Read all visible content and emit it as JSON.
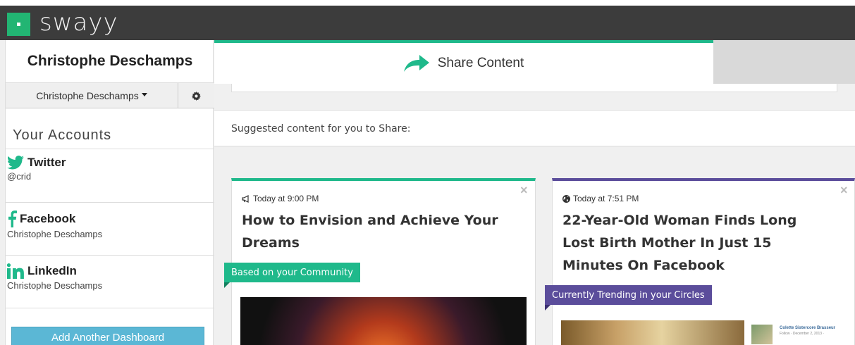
{
  "app": {
    "logo_text": "swayy"
  },
  "sidebar": {
    "user_name": "Christophe Deschamps",
    "user_dropdown": "Christophe Deschamps",
    "accounts_title": "Your Accounts",
    "accounts": [
      {
        "network": "Twitter",
        "handle": "@crid",
        "icon": "twitter-icon",
        "color": "#1fb98b"
      },
      {
        "network": "Facebook",
        "handle": "Christophe Deschamps",
        "icon": "facebook-icon",
        "color": "#1fb98b"
      },
      {
        "network": "LinkedIn",
        "handle": "Christophe Deschamps",
        "icon": "linkedin-icon",
        "color": "#1fb98b"
      }
    ],
    "add_dashboard": "Add Another Dashboard"
  },
  "main": {
    "tab_label": "Share Content",
    "suggested_label": "Suggested content for you to Share:",
    "cards": [
      {
        "time": "Today at 9:00 PM",
        "time_icon": "megaphone-icon",
        "title_lines": [
          "How to Envision and Achieve Your",
          "Dreams"
        ],
        "tag": "Based on your Community",
        "close": "×"
      },
      {
        "time": "Today at 7:51 PM",
        "time_icon": "globe-icon",
        "title_lines": [
          "22-Year-Old Woman Finds Long",
          "Lost Birth Mother In Just 15",
          "Minutes On Facebook"
        ],
        "tag": "Currently Trending in your Circles",
        "close": "×",
        "thumb_name": "Colette Sistercore Brasseur",
        "thumb_meta": "Follow · December 2, 2013 ·"
      }
    ]
  },
  "colors": {
    "accent_green": "#1fb98b",
    "accent_purple": "#5b4d9b",
    "topbar": "#3c3c3c",
    "button_blue": "#5bb7d5"
  }
}
